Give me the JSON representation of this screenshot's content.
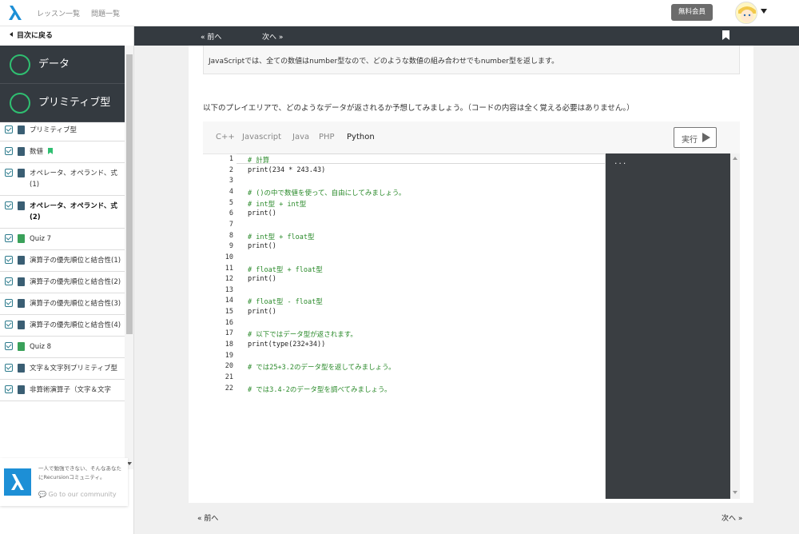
{
  "header": {
    "nav": [
      "レッスン一覧",
      "問題一覧"
    ],
    "plan_label": "無料会員",
    "brand_color": "#1d8fd6"
  },
  "sidebar": {
    "back_label": "目次に戻る",
    "sections": [
      {
        "label": "データ",
        "icon": "circle-outline-icon"
      },
      {
        "label": "プリミティブ型",
        "icon": "circle-outline-icon"
      }
    ],
    "lessons": [
      {
        "label": "プリミティブ型",
        "type": "lesson",
        "checked": true,
        "bookmarked": false
      },
      {
        "label": "数値",
        "type": "lesson",
        "checked": true,
        "bookmarked": true
      },
      {
        "label": "オペレータ、オペランド、式(1)",
        "type": "lesson",
        "checked": true,
        "bookmarked": false
      },
      {
        "label": "オペレータ、オペランド、式(2)",
        "type": "lesson",
        "checked": true,
        "bookmarked": false,
        "current": true
      },
      {
        "label": "Quiz 7",
        "type": "quiz",
        "checked": true,
        "bookmarked": false
      },
      {
        "label": "演算子の優先順位と結合性(1)",
        "type": "lesson",
        "checked": true,
        "bookmarked": false
      },
      {
        "label": "演算子の優先順位と結合性(2)",
        "type": "lesson",
        "checked": true,
        "bookmarked": false
      },
      {
        "label": "演算子の優先順位と結合性(3)",
        "type": "lesson",
        "checked": true,
        "bookmarked": false
      },
      {
        "label": "演算子の優先順位と結合性(4)",
        "type": "lesson",
        "checked": true,
        "bookmarked": false
      },
      {
        "label": "Quiz 8",
        "type": "quiz",
        "checked": true,
        "bookmarked": false
      },
      {
        "label": "文字＆文字列プリミティブ型",
        "type": "lesson",
        "checked": true,
        "bookmarked": false
      },
      {
        "label": "非算術演算子（文字＆文字",
        "type": "lesson",
        "checked": true,
        "bookmarked": false
      }
    ],
    "community": {
      "text": "一人で勉強できない、そんなあなたにRecursionコミュニティ。",
      "link": "Go to our community"
    }
  },
  "content_nav": {
    "prev": "« 前へ",
    "next": "次へ »"
  },
  "main": {
    "info_text": "JavaScriptでは、全ての数値はnumber型なので、どのような数値の組み合わせでもnumber型を返します。",
    "instruction": "以下のプレイエリアで、どのようなデータが返されるか予想してみましょう。（コードの内容は全く覚える必要はありません。）",
    "languages": [
      "C++",
      "Javascript",
      "Java",
      "PHP",
      "Python"
    ],
    "active_language": "Python",
    "run_label": "実行",
    "code_lines": [
      {
        "n": "1",
        "text": "# 計算",
        "comment": true
      },
      {
        "n": "2",
        "text": "print(234 * 243.43)",
        "comment": false
      },
      {
        "n": "3",
        "text": "",
        "comment": false
      },
      {
        "n": "4",
        "text": "# ()の中で数値を使って、自由にしてみましょう。",
        "comment": true
      },
      {
        "n": "5",
        "text": "# int型 + int型",
        "comment": true
      },
      {
        "n": "6",
        "text": "print()",
        "comment": false
      },
      {
        "n": "7",
        "text": "",
        "comment": false
      },
      {
        "n": "8",
        "text": "# int型 + float型",
        "comment": true
      },
      {
        "n": "9",
        "text": "print()",
        "comment": false
      },
      {
        "n": "10",
        "text": "",
        "comment": false
      },
      {
        "n": "11",
        "text": "# float型 + float型",
        "comment": true
      },
      {
        "n": "12",
        "text": "print()",
        "comment": false
      },
      {
        "n": "13",
        "text": "",
        "comment": false
      },
      {
        "n": "14",
        "text": "# float型 - float型",
        "comment": true
      },
      {
        "n": "15",
        "text": "print()",
        "comment": false
      },
      {
        "n": "16",
        "text": "",
        "comment": false
      },
      {
        "n": "17",
        "text": "# 以下ではデータ型が返されます。",
        "comment": true
      },
      {
        "n": "18",
        "text": "print(type(232+34))",
        "comment": false
      },
      {
        "n": "19",
        "text": "",
        "comment": false
      },
      {
        "n": "20",
        "text": "# では25+3.2のデータ型を返してみましょう。",
        "comment": true
      },
      {
        "n": "21",
        "text": "",
        "comment": false
      },
      {
        "n": "22",
        "text": "# では3.4-2のデータ型を調べてみましょう。",
        "comment": true
      }
    ],
    "output_text": "..."
  },
  "footer_nav": {
    "prev": "« 前へ",
    "next": "次へ »"
  }
}
